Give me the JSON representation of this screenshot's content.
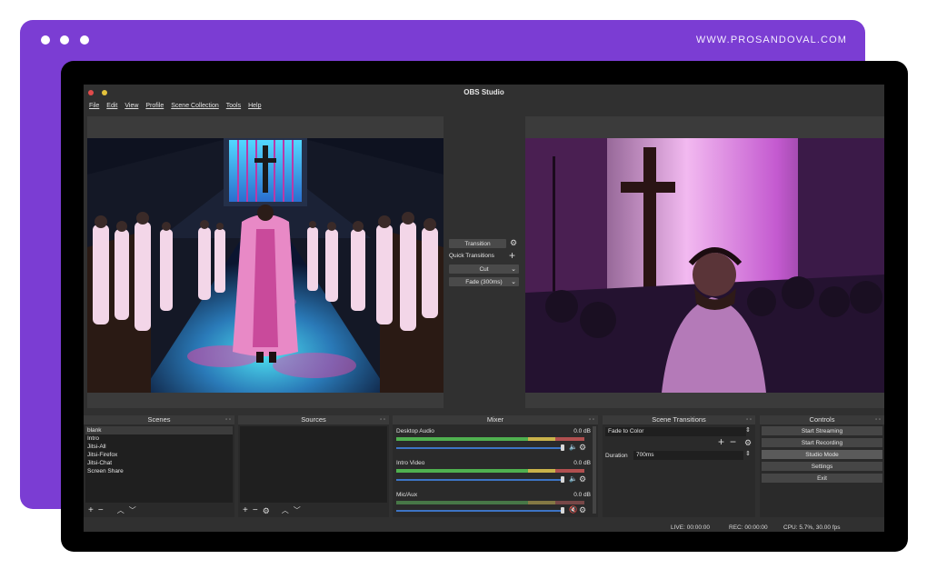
{
  "site": {
    "url": "WWW.PROSANDOVAL.COM"
  },
  "window": {
    "title": "OBS Studio"
  },
  "menu": [
    "File",
    "Edit",
    "View",
    "Profile",
    "Scene Collection",
    "Tools",
    "Help"
  ],
  "transition_panel": {
    "transition_button": "Transition",
    "quick_transitions": "Quick Transitions",
    "cut": "Cut",
    "fade": "Fade (300ms)"
  },
  "scenes": {
    "title": "Scenes",
    "items": [
      "blank",
      "Intro",
      "Jitsi-All",
      "Jitsi-Firefox",
      "Jitsi-Chat",
      "Screen Share"
    ]
  },
  "sources": {
    "title": "Sources"
  },
  "mixer": {
    "title": "Mixer",
    "channels": [
      {
        "name": "Desktop Audio",
        "db": "0.0 dB",
        "muted": false
      },
      {
        "name": "Intro Video",
        "db": "0.0 dB",
        "muted": false
      },
      {
        "name": "Mic/Aux",
        "db": "0.0 dB",
        "muted": true
      }
    ]
  },
  "scene_transitions": {
    "title": "Scene Transitions",
    "selected": "Fade to Color",
    "duration_label": "Duration",
    "duration_value": "700ms"
  },
  "controls": {
    "title": "Controls",
    "buttons": [
      "Start Streaming",
      "Start Recording",
      "Studio Mode",
      "Settings",
      "Exit"
    ]
  },
  "status": {
    "live": "LIVE: 00:00:00",
    "rec": "REC: 00:00:00",
    "cpu": "CPU: 5.7%, 30.00 fps"
  },
  "colors": {
    "brand_purple": "#7b3dd3",
    "obs_bg": "#303030",
    "meter_green": "#4fb04f",
    "slider_blue": "#3d74c4"
  }
}
